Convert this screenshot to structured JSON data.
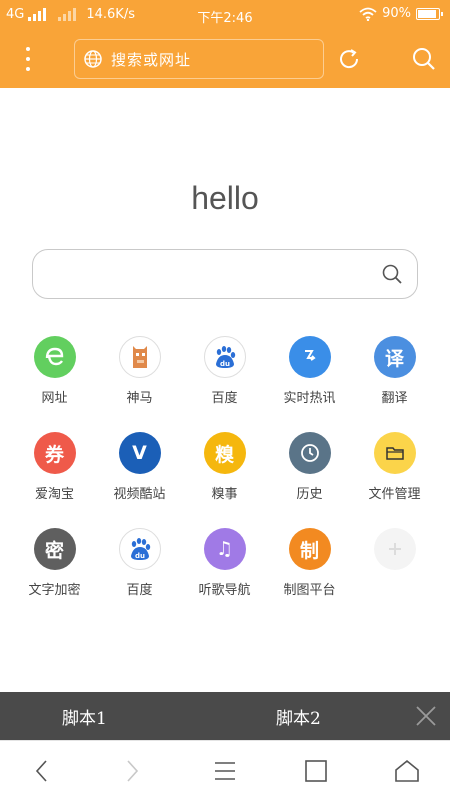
{
  "status_bar": {
    "network": "4G",
    "speed": "14.6K/s",
    "time": "下午2:46",
    "battery": "90%",
    "battery_level": 0.9
  },
  "toolbar": {
    "address_placeholder": "搜索或网址",
    "icons": [
      "menu-icon",
      "globe-icon",
      "refresh-icon",
      "search-icon"
    ]
  },
  "main": {
    "title": "hello",
    "search_value": ""
  },
  "grid": [
    {
      "label": "网址",
      "icon": "e",
      "color": "#62cf5f",
      "icon_name": "web-icon"
    },
    {
      "label": "神马",
      "icon": "",
      "color": "#ffffff",
      "icon_name": "shenma-icon"
    },
    {
      "label": "百度",
      "icon": "du",
      "color": "#ffffff",
      "icon_name": "baidu-icon"
    },
    {
      "label": "实时热讯",
      "icon": "",
      "color": "#3a8ee8",
      "icon_name": "hot-news-icon"
    },
    {
      "label": "翻译",
      "icon": "译",
      "color": "#4b8fe0",
      "icon_name": "translate-icon"
    },
    {
      "label": "爱淘宝",
      "icon": "券",
      "color": "#ef5a4a",
      "icon_name": "taobao-icon"
    },
    {
      "label": "视频酷站",
      "icon": "V",
      "color": "#1b5fb7",
      "icon_name": "video-icon"
    },
    {
      "label": "糗事",
      "icon": "糗",
      "color": "#f5b70e",
      "icon_name": "qiushi-icon"
    },
    {
      "label": "历史",
      "icon": "",
      "color": "#5a7488",
      "icon_name": "history-icon"
    },
    {
      "label": "文件管理",
      "icon": "",
      "color": "#fbd44a",
      "icon_name": "folder-icon"
    },
    {
      "label": "文字加密",
      "icon": "密",
      "color": "#5f5f5f",
      "icon_name": "encrypt-icon"
    },
    {
      "label": "百度",
      "icon": "du",
      "color": "#ffffff",
      "icon_name": "baidu-icon"
    },
    {
      "label": "听歌导航",
      "icon": "♫",
      "color": "#a07ae6",
      "icon_name": "music-icon"
    },
    {
      "label": "制图平台",
      "icon": "制",
      "color": "#f28a21",
      "icon_name": "drawing-icon"
    },
    {
      "label": "",
      "icon": "+",
      "color": "#f4f4f4",
      "icon_name": "add-icon"
    }
  ],
  "script_bar": {
    "script1": "脚本1",
    "script2": "脚本2"
  },
  "bottom_nav": [
    "back-icon",
    "forward-icon",
    "menu-icon",
    "tabs-icon",
    "home-icon"
  ]
}
